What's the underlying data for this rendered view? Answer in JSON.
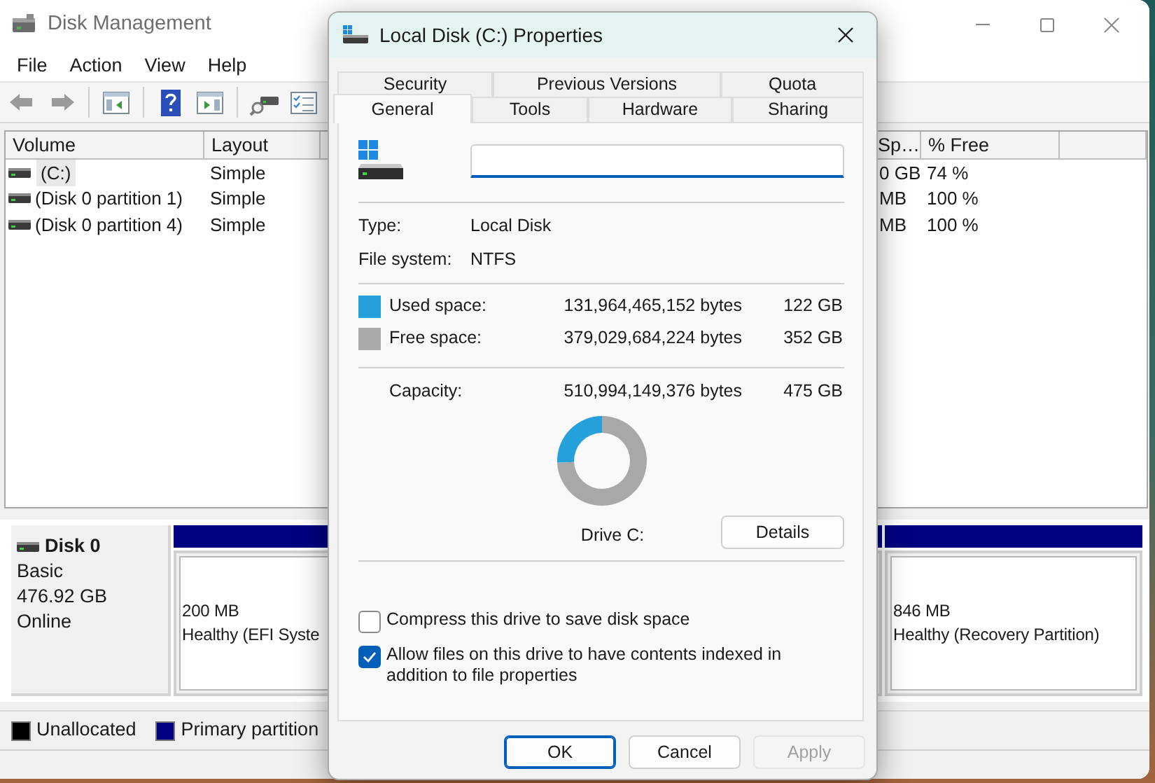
{
  "main_window": {
    "title": "Disk Management",
    "menu": [
      "File",
      "Action",
      "View",
      "Help"
    ],
    "volumes": {
      "columns": [
        "Volume",
        "Layout",
        "Sp…",
        "% Free"
      ],
      "rows": [
        {
          "cells": [
            "(C:)",
            "Simple",
            "0 GB",
            "74 %"
          ],
          "selected": true
        },
        {
          "cells": [
            "(Disk 0 partition 1)",
            "Simple",
            "MB",
            "100 %"
          ],
          "selected": false
        },
        {
          "cells": [
            "(Disk 0 partition 4)",
            "Simple",
            "MB",
            "100 %"
          ],
          "selected": false
        }
      ]
    },
    "disk": {
      "name": "Disk 0",
      "type": "Basic",
      "size": "476.92 GB",
      "status": "Online"
    },
    "partitions": [
      {
        "size": "200 MB",
        "status": "Healthy (EFI Syste"
      },
      {
        "size": "846 MB",
        "status": "Healthy (Recovery Partition)"
      }
    ],
    "legend": [
      {
        "label": "Unallocated",
        "color": "#000000"
      },
      {
        "label": "Primary partition",
        "color": "#000080"
      }
    ]
  },
  "dialog": {
    "title": "Local Disk (C:) Properties",
    "tabs_back": [
      {
        "label": "Security",
        "selected": false
      },
      {
        "label": "Previous Versions",
        "selected": false
      },
      {
        "label": "Quota",
        "selected": false
      }
    ],
    "tabs_front": [
      {
        "label": "General",
        "selected": true
      },
      {
        "label": "Tools",
        "selected": false
      },
      {
        "label": "Hardware",
        "selected": false
      },
      {
        "label": "Sharing",
        "selected": false
      }
    ],
    "info": [
      {
        "label": "Type:",
        "value": "Local Disk"
      },
      {
        "label": "File system:",
        "value": "NTFS"
      }
    ],
    "space": [
      {
        "label": "Used space:",
        "bytes": "131,964,465,152 bytes",
        "size": "122 GB",
        "color": "#26a0da"
      },
      {
        "label": "Free space:",
        "bytes": "379,029,684,224 bytes",
        "size": "352 GB",
        "color": "#a8a8a8"
      }
    ],
    "capacity": {
      "label": "Capacity:",
      "bytes": "510,994,149,376 bytes",
      "size": "475 GB"
    },
    "chart_data": {
      "type": "donut",
      "values": [
        25.7,
        74.3
      ]
    },
    "drive_label": "Drive C:",
    "details_button": "Details",
    "options": [
      {
        "label": "Compress this drive to save disk space",
        "checked": false
      },
      {
        "label": "Allow files on this drive to have contents indexed in addition to file properties",
        "checked": true
      }
    ],
    "buttons": [
      {
        "label": "OK",
        "kind": "default",
        "disabled": false
      },
      {
        "label": "Cancel",
        "kind": "normal",
        "disabled": false
      },
      {
        "label": "Apply",
        "kind": "normal",
        "disabled": true
      }
    ]
  }
}
